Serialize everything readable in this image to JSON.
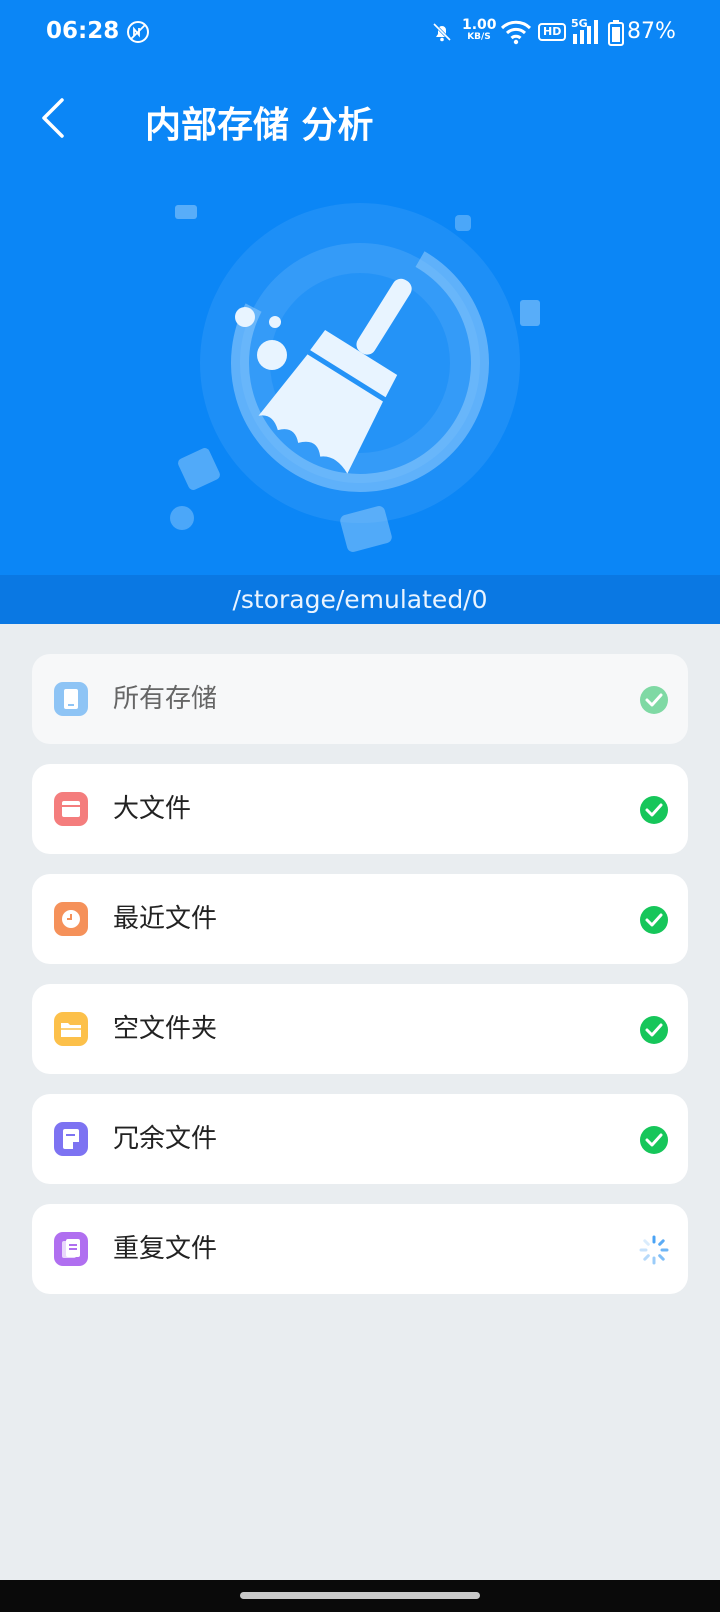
{
  "status_bar": {
    "time": "06:28",
    "speed_value": "1.00",
    "speed_unit": "KB/S",
    "hd": "HD",
    "network": "5G",
    "battery": "87%"
  },
  "header": {
    "title": "内部存储 分析"
  },
  "path": "/storage/emulated/0",
  "items": [
    {
      "label": "所有存储",
      "icon": "phone-icon",
      "color": "#8ec4f5",
      "state": "done-dim"
    },
    {
      "label": "大文件",
      "icon": "folder-icon",
      "color": "#f47d7d",
      "state": "done"
    },
    {
      "label": "最近文件",
      "icon": "clock-icon",
      "color": "#f5915a",
      "state": "done"
    },
    {
      "label": "空文件夹",
      "icon": "open-folder-icon",
      "color": "#fcc04a",
      "state": "done"
    },
    {
      "label": "冗余文件",
      "icon": "document-icon",
      "color": "#7d73f2",
      "state": "done"
    },
    {
      "label": "重复文件",
      "icon": "copy-icon",
      "color": "#b06ff0",
      "state": "loading"
    }
  ],
  "colors": {
    "hero_blue": "#0b86f6",
    "path_bar": "#0a78e3",
    "check_green": "#16c65a",
    "background": "#e9edf0"
  }
}
